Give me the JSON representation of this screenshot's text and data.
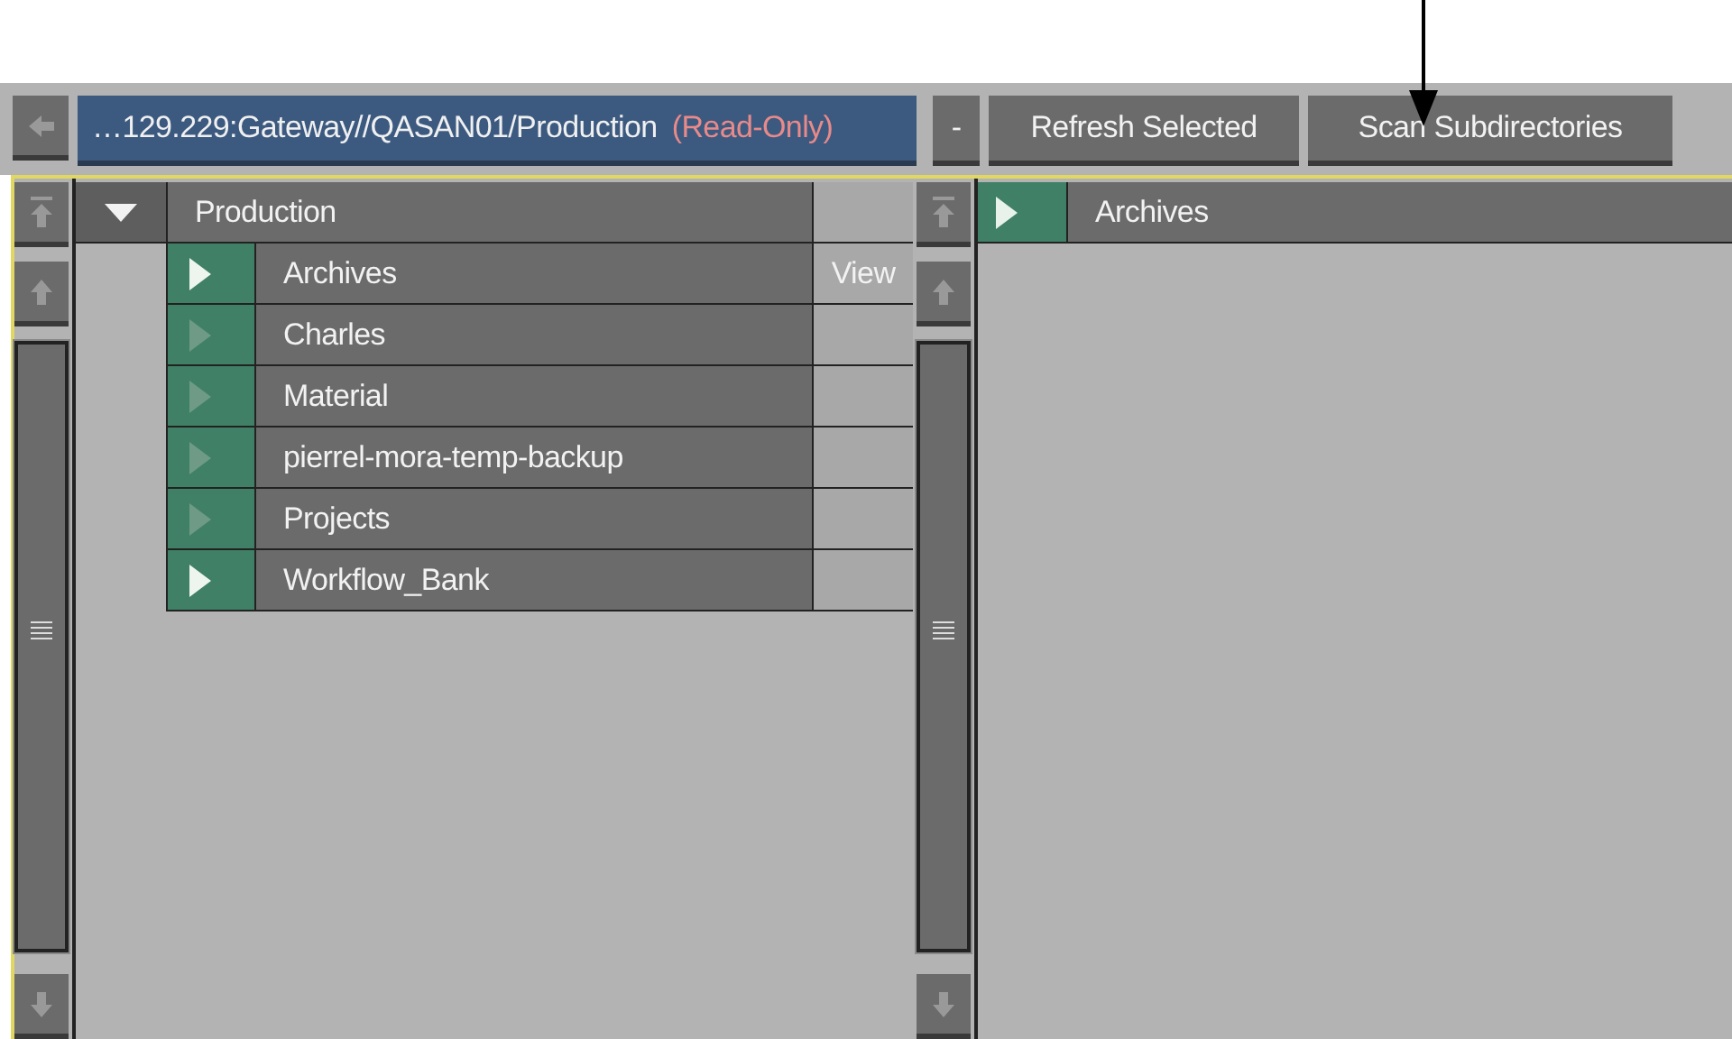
{
  "toolbar": {
    "path": "…129.229:Gateway//QASAN01/Production",
    "access": "(Read-Only)",
    "buttons": [
      {
        "label": "-"
      },
      {
        "label": "Refresh Selected"
      },
      {
        "label": "Scan Subdirectories"
      }
    ]
  },
  "left_tree": {
    "root": {
      "label": "Production",
      "expanded": true
    },
    "rows": [
      {
        "label": "Archives",
        "has_children": true,
        "view": "View"
      },
      {
        "label": "Charles",
        "has_children": false
      },
      {
        "label": "Material",
        "has_children": false
      },
      {
        "label": "pierrel-mora-temp-backup",
        "has_children": false
      },
      {
        "label": "Projects",
        "has_children": false
      },
      {
        "label": "Workflow_Bank",
        "has_children": true
      }
    ]
  },
  "right_tree": {
    "root": {
      "label": "Archives",
      "expanded": false
    }
  }
}
